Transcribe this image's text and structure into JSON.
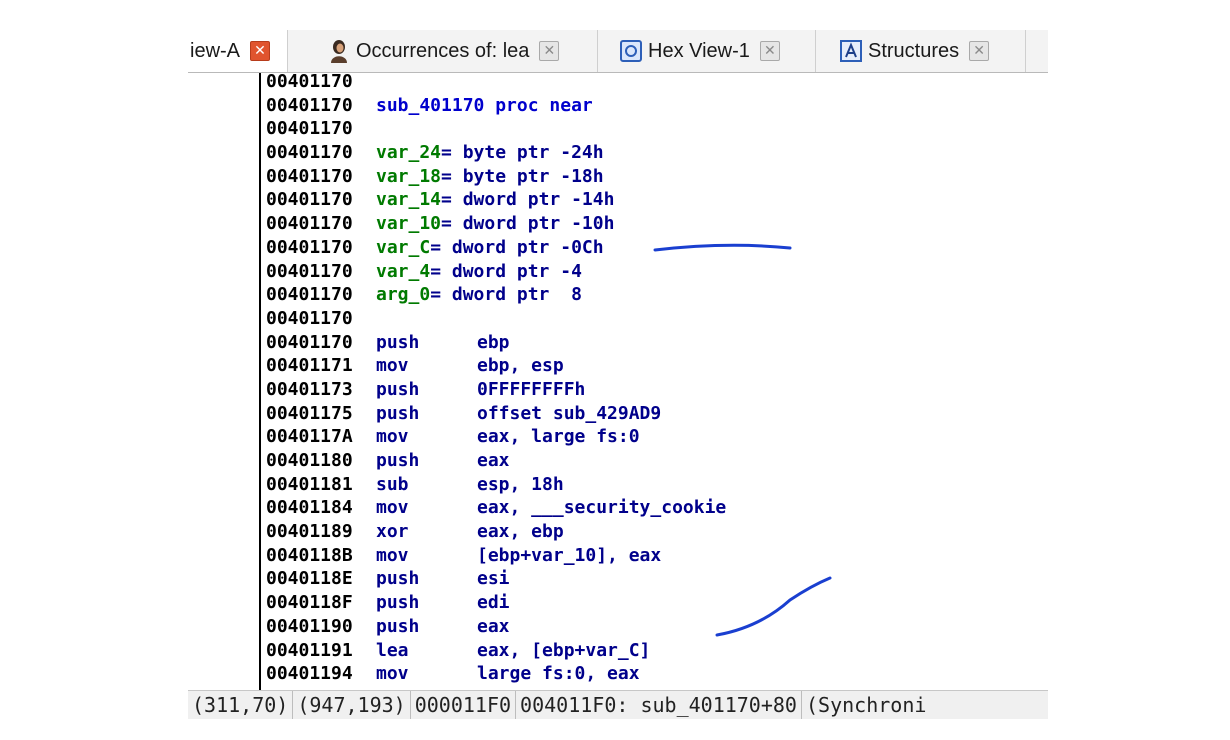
{
  "tabs": [
    {
      "label": "iew-A",
      "icon": "",
      "close": "✕",
      "active": true
    },
    {
      "label": "Occurrences of: lea",
      "icon": "person-icon",
      "close": "✕",
      "active": false
    },
    {
      "label": "Hex View-1",
      "icon": "hex-view-icon",
      "close": "✕",
      "active": false
    },
    {
      "label": "Structures",
      "icon": "structures-icon",
      "close": "✕",
      "active": false
    }
  ],
  "code": {
    "lines": [
      {
        "addr": "00401170"
      },
      {
        "addr": "00401170",
        "text": "sub_401170 proc near"
      },
      {
        "addr": "00401170"
      },
      {
        "addr": "00401170",
        "var": "var_24",
        "def": "= byte ptr -24h"
      },
      {
        "addr": "00401170",
        "var": "var_18",
        "def": "= byte ptr -18h"
      },
      {
        "addr": "00401170",
        "var": "var_14",
        "def": "= dword ptr -14h"
      },
      {
        "addr": "00401170",
        "var": "var_10",
        "def": "= dword ptr -10h"
      },
      {
        "addr": "00401170",
        "var": "var_C",
        "def": "= dword ptr -0Ch"
      },
      {
        "addr": "00401170",
        "var": "var_4",
        "def": "= dword ptr -4"
      },
      {
        "addr": "00401170",
        "var": "arg_0",
        "def": "= dword ptr  8"
      },
      {
        "addr": "00401170"
      },
      {
        "addr": "00401170",
        "mn": "push",
        "op": "ebp"
      },
      {
        "addr": "00401171",
        "mn": "mov",
        "op": "ebp, esp"
      },
      {
        "addr": "00401173",
        "mn": "push",
        "op": "0FFFFFFFFh"
      },
      {
        "addr": "00401175",
        "mn": "push",
        "op": "offset sub_429AD9"
      },
      {
        "addr": "0040117A",
        "mn": "mov",
        "op": "eax, large fs:0"
      },
      {
        "addr": "00401180",
        "mn": "push",
        "op": "eax"
      },
      {
        "addr": "00401181",
        "mn": "sub",
        "op": "esp, 18h"
      },
      {
        "addr": "00401184",
        "mn": "mov",
        "op": "eax, ___security_cookie"
      },
      {
        "addr": "00401189",
        "mn": "xor",
        "op": "eax, ebp"
      },
      {
        "addr": "0040118B",
        "mn": "mov",
        "op": "[ebp+var_10], eax"
      },
      {
        "addr": "0040118E",
        "mn": "push",
        "op": "esi"
      },
      {
        "addr": "0040118F",
        "mn": "push",
        "op": "edi"
      },
      {
        "addr": "00401190",
        "mn": "push",
        "op": "eax"
      },
      {
        "addr": "00401191",
        "mn": "lea",
        "op": "eax, [ebp+var_C]"
      },
      {
        "addr": "00401194",
        "mn": "mov",
        "op": "large fs:0, eax"
      }
    ]
  },
  "status": {
    "cells": [
      "(311,70)",
      "(947,193)",
      "000011F0",
      "004011F0: sub_401170+80",
      "(Synchroni"
    ]
  },
  "annotations": {
    "pen_color": "#1a3fd0"
  }
}
